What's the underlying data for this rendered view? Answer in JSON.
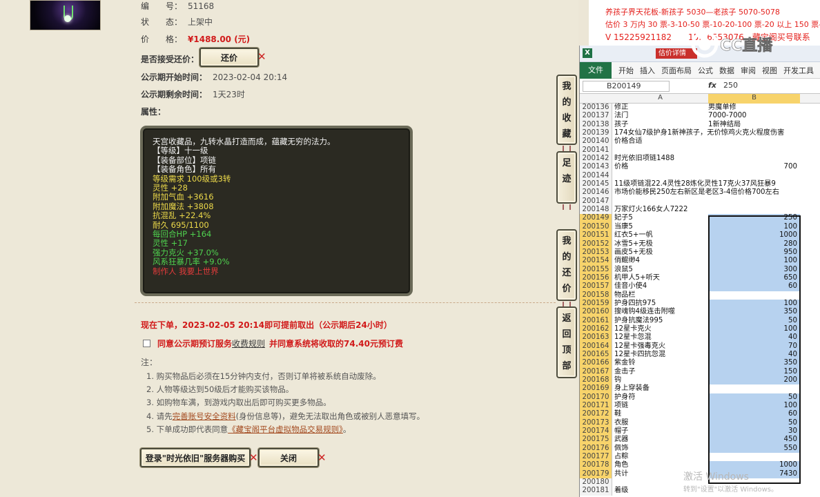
{
  "item": {
    "number_label": "编　　号：",
    "number": "51168",
    "status_label": "状　　态：",
    "status": "上架中",
    "price_label": "价　　格：",
    "price": "¥1488.00 (元)",
    "bargain_label": "是否接受还价：",
    "bargain_button": "还价",
    "pub_start_label": "公示期开始时间：",
    "pub_start": "2023-02-04 20:14",
    "pub_remain_label": "公示期剩余时间：",
    "pub_remain": "1天23时",
    "attr_label": "属性："
  },
  "attributes": [
    {
      "text": "天宫收藏品，九转水晶打造而成，蕴藏无穷的法力。",
      "color": "w"
    },
    {
      "text": "【等级】十一级",
      "color": "w"
    },
    {
      "text": "【装备部位】项链",
      "color": "w"
    },
    {
      "text": "【装备角色】所有",
      "color": "w"
    },
    {
      "text": "等级需求 100级或3转",
      "color": "y"
    },
    {
      "text": "灵性 +28",
      "color": "y"
    },
    {
      "text": "附加气血 +3616",
      "color": "y"
    },
    {
      "text": "附加魔法 +3808",
      "color": "y"
    },
    {
      "text": "抗混乱 +22.4%",
      "color": "y"
    },
    {
      "text": "耐久 695/1100",
      "color": "y"
    },
    {
      "text": "每回合HP +164",
      "color": "g"
    },
    {
      "text": "灵性 +17",
      "color": "g"
    },
    {
      "text": "强力克火 +37.0%",
      "color": "g"
    },
    {
      "text": "风系狂暴几率 +9.0%",
      "color": "g"
    },
    {
      "text": "制作人 我要上世界",
      "color": "r"
    }
  ],
  "order": {
    "notice": "现在下单，2023-02-05 20:14即可提前取出（公示期后24小时）",
    "agree_pre": "同意公示期预订服务",
    "agree_link": "收费规则",
    "agree_post": "并同意系统将收取的74.40元预订费"
  },
  "notes": {
    "title": "注：",
    "n1": "1. 购买物品后必须在15分钟内支付，否则订单将被系统自动废除。",
    "n2": "2. 人物等级达到50级后才能购买该物品。",
    "n3": "3. 如购物车满，到游戏内取出后即可购买更多物品。",
    "n4_pre": "4. 请先",
    "n4_link": "完善账号安全资料",
    "n4_post": "(身份信息等)，避免无法取出角色或被别人恶意填写。",
    "n5_pre": "5. 下单成功即代表同意",
    "n5_link": "《藏宝阁平台虚拟物品交易规则》",
    "n5_post": "。"
  },
  "buttons": {
    "buy": "登录\"时光依旧\"服务器购买",
    "close": "关闭"
  },
  "side": {
    "fav": "我的收藏",
    "track": "足迹",
    "bargain": "我的还价",
    "top": "返回顶部"
  },
  "overlay": {
    "line1": "养孩子界天花板-新孩子 5030—老孩子 5070-5078",
    "line2": "估价 3 万内 30 票-3-10-50 票-10-20-100 票-20 以上 150 票-1 票",
    "line3": "V 15225921182　　15…6553076　藏宝阁买号联系",
    "logo_text": "CC直播"
  },
  "excel": {
    "doc_tab": "估价详情",
    "ribbon": [
      "文件",
      "开始",
      "插入",
      "页面布局",
      "公式",
      "数据",
      "审阅",
      "视图",
      "开发工具"
    ],
    "name_box": "B200149",
    "fx": "fx",
    "formula_value": "250",
    "col_a": "A",
    "col_b": "B",
    "rows": [
      {
        "n": "200136",
        "a": "修正",
        "b": "男魔单修",
        "num": false,
        "sel": false
      },
      {
        "n": "200137",
        "a": "法门",
        "b": "7000-7000",
        "num": false,
        "sel": false
      },
      {
        "n": "200138",
        "a": "孩子",
        "b": "1新神结局",
        "num": false,
        "sel": false
      },
      {
        "n": "200139",
        "a": "174女仙7级护身1新神孩子，无价惊鸡火克火程度伤害",
        "b": "",
        "num": false,
        "sel": false
      },
      {
        "n": "200140",
        "a": "价格合适",
        "b": "",
        "num": false,
        "sel": false
      },
      {
        "n": "200141",
        "a": "",
        "b": "",
        "num": false,
        "sel": false
      },
      {
        "n": "200142",
        "a": "时光依旧项链1488",
        "b": "",
        "num": false,
        "sel": false
      },
      {
        "n": "200143",
        "a": "价格",
        "b": "700",
        "num": true,
        "sel": false
      },
      {
        "n": "200144",
        "a": "",
        "b": "",
        "num": false,
        "sel": false
      },
      {
        "n": "200145",
        "a": "11级项链混22.4灵性28炼化灵性17克火37风狂暴9",
        "b": "",
        "num": false,
        "sel": false
      },
      {
        "n": "200146",
        "a": "市场价能移民250左右新区是老区3-4倍价格700左右",
        "b": "",
        "num": false,
        "sel": false
      },
      {
        "n": "200147",
        "a": "",
        "b": "",
        "num": false,
        "sel": false
      },
      {
        "n": "200148",
        "a": "万家灯火166女人7222",
        "b": "",
        "num": false,
        "sel": false
      },
      {
        "n": "200149",
        "a": "妃子5",
        "b": "250",
        "num": true,
        "sel": true
      },
      {
        "n": "200150",
        "a": "当康5",
        "b": "100",
        "num": true,
        "sel": true
      },
      {
        "n": "200151",
        "a": "红衣5+一帆",
        "b": "1000",
        "num": true,
        "sel": true
      },
      {
        "n": "200152",
        "a": "冰雪5+无极",
        "b": "280",
        "num": true,
        "sel": true
      },
      {
        "n": "200153",
        "a": "画皮5+无极",
        "b": "950",
        "num": true,
        "sel": true
      },
      {
        "n": "200154",
        "a": "俏鲲缈4",
        "b": "100",
        "num": true,
        "sel": true
      },
      {
        "n": "200155",
        "a": "浪鼠5",
        "b": "300",
        "num": true,
        "sel": true
      },
      {
        "n": "200156",
        "a": "机甲人5+听天",
        "b": "650",
        "num": true,
        "sel": true
      },
      {
        "n": "200157",
        "a": "佳音小使4",
        "b": "60",
        "num": true,
        "sel": true
      },
      {
        "n": "200158",
        "a": "物品栏",
        "b": "",
        "num": true,
        "sel": true
      },
      {
        "n": "200159",
        "a": "护身四抗975",
        "b": "100",
        "num": true,
        "sel": true
      },
      {
        "n": "200160",
        "a": "搜魂钩4级连击附噬",
        "b": "350",
        "num": true,
        "sel": true
      },
      {
        "n": "200161",
        "a": "护身抗魔法995",
        "b": "50",
        "num": true,
        "sel": true
      },
      {
        "n": "200162",
        "a": "12星卡克火",
        "b": "100",
        "num": true,
        "sel": true
      },
      {
        "n": "200163",
        "a": "12星卡忽混",
        "b": "40",
        "num": true,
        "sel": true
      },
      {
        "n": "200164",
        "a": "12星卡强毒克火",
        "b": "70",
        "num": true,
        "sel": true
      },
      {
        "n": "200165",
        "a": "12星卡四抗忽混",
        "b": "40",
        "num": true,
        "sel": true
      },
      {
        "n": "200166",
        "a": "紫金铃",
        "b": "350",
        "num": true,
        "sel": true
      },
      {
        "n": "200167",
        "a": "金击子",
        "b": "150",
        "num": true,
        "sel": true
      },
      {
        "n": "200168",
        "a": "钩",
        "b": "200",
        "num": true,
        "sel": true
      },
      {
        "n": "200169",
        "a": "身上穿装备",
        "b": "",
        "num": true,
        "sel": true
      },
      {
        "n": "200170",
        "a": "护身符",
        "b": "50",
        "num": true,
        "sel": true
      },
      {
        "n": "200171",
        "a": "项链",
        "b": "100",
        "num": true,
        "sel": true
      },
      {
        "n": "200172",
        "a": "鞋",
        "b": "60",
        "num": true,
        "sel": true
      },
      {
        "n": "200173",
        "a": "衣服",
        "b": "50",
        "num": true,
        "sel": true
      },
      {
        "n": "200174",
        "a": "帽子",
        "b": "30",
        "num": true,
        "sel": true
      },
      {
        "n": "200175",
        "a": "武器",
        "b": "450",
        "num": true,
        "sel": true
      },
      {
        "n": "200176",
        "a": "佩饰",
        "b": "550",
        "num": true,
        "sel": true
      },
      {
        "n": "200177",
        "a": "占粽",
        "b": "",
        "num": true,
        "sel": true
      },
      {
        "n": "200178",
        "a": "角色",
        "b": "1000",
        "num": true,
        "sel": true
      },
      {
        "n": "200179",
        "a": "共计",
        "b": "7430",
        "num": true,
        "sel": true
      },
      {
        "n": "200180",
        "a": "",
        "b": "",
        "num": false,
        "sel": false
      },
      {
        "n": "200181",
        "a": "着级",
        "b": "",
        "num": false,
        "sel": false
      }
    ],
    "watermark1": "激活 Windows",
    "watermark2": "转到\"设置\"以激活 Windows。"
  }
}
